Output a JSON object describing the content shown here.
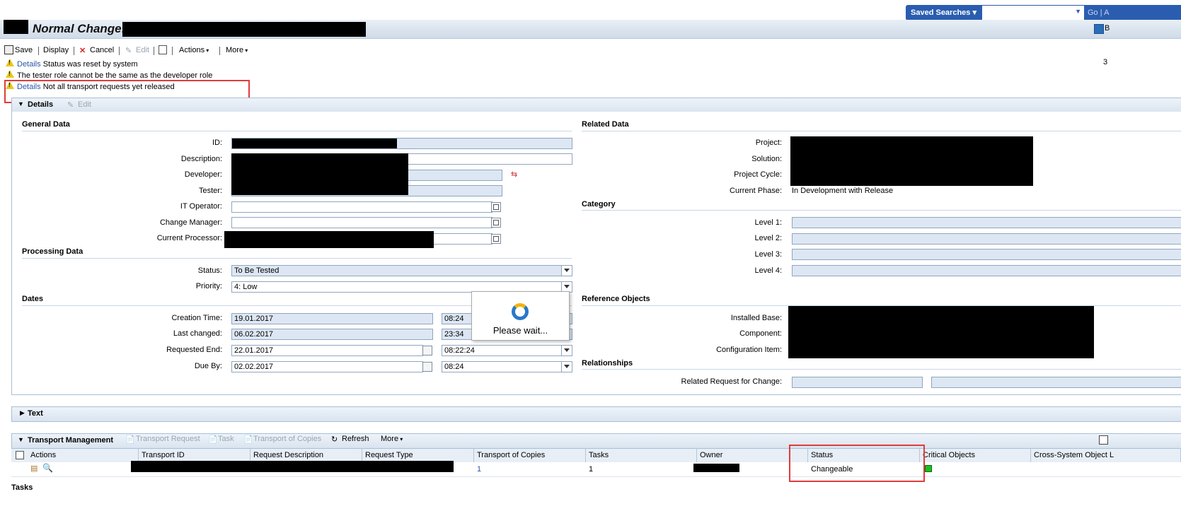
{
  "search": {
    "saved_label": "Saved Searches",
    "go_label": "Go",
    "advanced_label": "A"
  },
  "header": {
    "title": "Normal Change:",
    "back_label": "B"
  },
  "toolbar": {
    "save": "Save",
    "display": "Display",
    "cancel": "Cancel",
    "edit": "Edit",
    "actions": "Actions",
    "more": "More"
  },
  "messages": {
    "m1_link": "Details",
    "m1_text": "Status was reset by system",
    "m2_text": "The tester role cannot be the same as the developer role",
    "m3_link": "Details",
    "m3_text": "Not all transport requests yet released",
    "count": "3"
  },
  "details": {
    "header": "Details",
    "edit": "Edit",
    "general": {
      "title": "General Data",
      "id_label": "ID:",
      "description_label": "Description:",
      "developer_label": "Developer:",
      "tester_label": "Tester:",
      "it_operator_label": "IT Operator:",
      "change_manager_label": "Change Manager:",
      "current_processor_label": "Current Processor:"
    },
    "processing": {
      "title": "Processing Data",
      "status_label": "Status:",
      "status_value": "To Be Tested",
      "priority_label": "Priority:",
      "priority_value": "4: Low"
    },
    "dates": {
      "title": "Dates",
      "creation_label": "Creation Time:",
      "creation_date": "19.01.2017",
      "creation_time": "08:24",
      "changed_label": "Last changed:",
      "changed_date": "06.02.2017",
      "changed_time": "23:34",
      "requested_label": "Requested End:",
      "requested_date": "22.01.2017",
      "requested_time": "08:22:24",
      "due_label": "Due By:",
      "due_date": "02.02.2017",
      "due_time": "08:24"
    },
    "related": {
      "title": "Related Data",
      "project_label": "Project:",
      "solution_label": "Solution:",
      "cycle_label": "Project Cycle:",
      "phase_label": "Current Phase:",
      "phase_value": "In Development with Release"
    },
    "category": {
      "title": "Category",
      "l1": "Level 1:",
      "l2": "Level 2:",
      "l3": "Level 3:",
      "l4": "Level 4:"
    },
    "reference": {
      "title": "Reference Objects",
      "installed_label": "Installed Base:",
      "component_label": "Component:",
      "config_label": "Configuration Item:"
    },
    "relationships": {
      "title": "Relationships",
      "rfc_label": "Related Request for Change:"
    }
  },
  "popup": {
    "text": "Please wait..."
  },
  "text_section": {
    "header": "Text"
  },
  "transport": {
    "header": "Transport Management",
    "tb_request": "Transport Request",
    "tb_task": "Task",
    "tb_copies": "Transport of Copies",
    "tb_refresh": "Refresh",
    "tb_more": "More",
    "columns": [
      "Actions",
      "Transport ID",
      "Request Description",
      "Request Type",
      "Transport of Copies",
      "Tasks",
      "Owner",
      "Status",
      "Critical Objects",
      "Cross-System Object L"
    ],
    "row": {
      "copies": "1",
      "tasks": "1",
      "status": "Changeable",
      "critical_color": "#18c020"
    }
  },
  "tasks_section": {
    "header": "Tasks"
  }
}
